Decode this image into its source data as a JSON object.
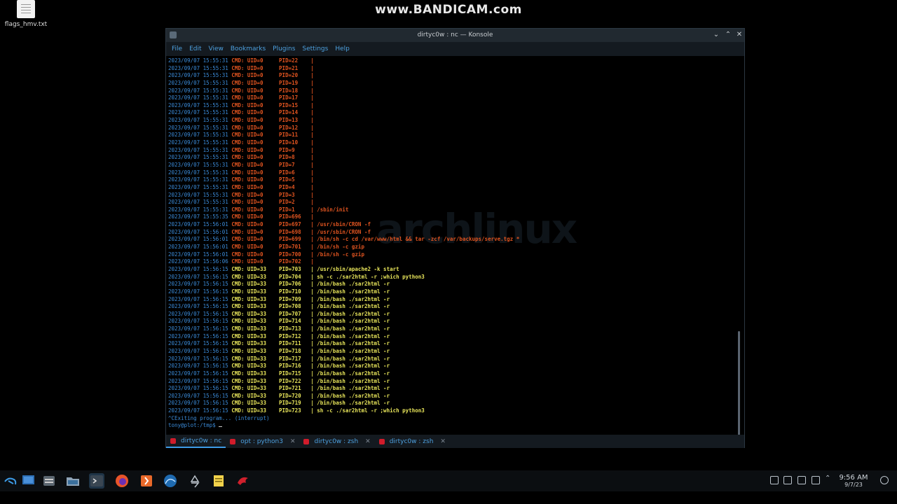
{
  "watermark": "www.BANDICAM.com",
  "desktop_icon": {
    "label": "flags_hmv.txt",
    "icon": "text-file-icon"
  },
  "window": {
    "title": "dirtyc0w : nc — Konsole",
    "controls": [
      "minimize-icon",
      "maximize-icon",
      "close-icon"
    ]
  },
  "menu": [
    "File",
    "Edit",
    "View",
    "Bookmarks",
    "Plugins",
    "Settings",
    "Help"
  ],
  "terminal": {
    "background_logo": "archlinux",
    "entries": [
      {
        "ts": "2023/09/07 15:55:31",
        "uid": "UID=0",
        "pid": "PID=22",
        "cmd": "",
        "color": "orange"
      },
      {
        "ts": "2023/09/07 15:55:31",
        "uid": "UID=0",
        "pid": "PID=21",
        "cmd": "",
        "color": "orange"
      },
      {
        "ts": "2023/09/07 15:55:31",
        "uid": "UID=0",
        "pid": "PID=20",
        "cmd": "",
        "color": "orange"
      },
      {
        "ts": "2023/09/07 15:55:31",
        "uid": "UID=0",
        "pid": "PID=19",
        "cmd": "",
        "color": "orange"
      },
      {
        "ts": "2023/09/07 15:55:31",
        "uid": "UID=0",
        "pid": "PID=18",
        "cmd": "",
        "color": "orange"
      },
      {
        "ts": "2023/09/07 15:55:31",
        "uid": "UID=0",
        "pid": "PID=17",
        "cmd": "",
        "color": "orange"
      },
      {
        "ts": "2023/09/07 15:55:31",
        "uid": "UID=0",
        "pid": "PID=15",
        "cmd": "",
        "color": "orange"
      },
      {
        "ts": "2023/09/07 15:55:31",
        "uid": "UID=0",
        "pid": "PID=14",
        "cmd": "",
        "color": "orange"
      },
      {
        "ts": "2023/09/07 15:55:31",
        "uid": "UID=0",
        "pid": "PID=13",
        "cmd": "",
        "color": "orange"
      },
      {
        "ts": "2023/09/07 15:55:31",
        "uid": "UID=0",
        "pid": "PID=12",
        "cmd": "",
        "color": "orange"
      },
      {
        "ts": "2023/09/07 15:55:31",
        "uid": "UID=0",
        "pid": "PID=11",
        "cmd": "",
        "color": "orange"
      },
      {
        "ts": "2023/09/07 15:55:31",
        "uid": "UID=0",
        "pid": "PID=10",
        "cmd": "",
        "color": "orange"
      },
      {
        "ts": "2023/09/07 15:55:31",
        "uid": "UID=0",
        "pid": "PID=9",
        "cmd": "",
        "color": "orange"
      },
      {
        "ts": "2023/09/07 15:55:31",
        "uid": "UID=0",
        "pid": "PID=8",
        "cmd": "",
        "color": "orange"
      },
      {
        "ts": "2023/09/07 15:55:31",
        "uid": "UID=0",
        "pid": "PID=7",
        "cmd": "",
        "color": "orange"
      },
      {
        "ts": "2023/09/07 15:55:31",
        "uid": "UID=0",
        "pid": "PID=6",
        "cmd": "",
        "color": "orange"
      },
      {
        "ts": "2023/09/07 15:55:31",
        "uid": "UID=0",
        "pid": "PID=5",
        "cmd": "",
        "color": "orange"
      },
      {
        "ts": "2023/09/07 15:55:31",
        "uid": "UID=0",
        "pid": "PID=4",
        "cmd": "",
        "color": "orange"
      },
      {
        "ts": "2023/09/07 15:55:31",
        "uid": "UID=0",
        "pid": "PID=3",
        "cmd": "",
        "color": "orange"
      },
      {
        "ts": "2023/09/07 15:55:31",
        "uid": "UID=0",
        "pid": "PID=2",
        "cmd": "",
        "color": "orange"
      },
      {
        "ts": "2023/09/07 15:55:31",
        "uid": "UID=0",
        "pid": "PID=1",
        "cmd": "/sbin/init",
        "color": "orange"
      },
      {
        "ts": "2023/09/07 15:55:35",
        "uid": "UID=0",
        "pid": "PID=696",
        "cmd": "",
        "color": "orange"
      },
      {
        "ts": "2023/09/07 15:56:01",
        "uid": "UID=0",
        "pid": "PID=697",
        "cmd": "/usr/sbin/CRON -f",
        "color": "orange"
      },
      {
        "ts": "2023/09/07 15:56:01",
        "uid": "UID=0",
        "pid": "PID=698",
        "cmd": "/usr/sbin/CRON -f",
        "color": "orange"
      },
      {
        "ts": "2023/09/07 15:56:01",
        "uid": "UID=0",
        "pid": "PID=699",
        "cmd": "/bin/sh -c cd /var/www/html && tar -zcf /var/backups/serve.tgz *",
        "color": "orange"
      },
      {
        "ts": "2023/09/07 15:56:01",
        "uid": "UID=0",
        "pid": "PID=701",
        "cmd": "/bin/sh -c gzip",
        "color": "orange"
      },
      {
        "ts": "2023/09/07 15:56:01",
        "uid": "UID=0",
        "pid": "PID=700",
        "cmd": "/bin/sh -c gzip",
        "color": "orange"
      },
      {
        "ts": "2023/09/07 15:56:06",
        "uid": "UID=0",
        "pid": "PID=702",
        "cmd": "",
        "color": "orange"
      },
      {
        "ts": "2023/09/07 15:56:15",
        "uid": "UID=33",
        "pid": "PID=703",
        "cmd": "/usr/sbin/apache2 -k start",
        "color": "yellow"
      },
      {
        "ts": "2023/09/07 15:56:15",
        "uid": "UID=33",
        "pid": "PID=704",
        "cmd": "sh -c ./sar2html -r ;which python3",
        "color": "yellow"
      },
      {
        "ts": "2023/09/07 15:56:15",
        "uid": "UID=33",
        "pid": "PID=706",
        "cmd": "/bin/bash ./sar2html -r",
        "color": "yellow"
      },
      {
        "ts": "2023/09/07 15:56:15",
        "uid": "UID=33",
        "pid": "PID=710",
        "cmd": "/bin/bash ./sar2html -r",
        "color": "yellow"
      },
      {
        "ts": "2023/09/07 15:56:15",
        "uid": "UID=33",
        "pid": "PID=709",
        "cmd": "/bin/bash ./sar2html -r",
        "color": "yellow"
      },
      {
        "ts": "2023/09/07 15:56:15",
        "uid": "UID=33",
        "pid": "PID=708",
        "cmd": "/bin/bash ./sar2html -r",
        "color": "yellow"
      },
      {
        "ts": "2023/09/07 15:56:15",
        "uid": "UID=33",
        "pid": "PID=707",
        "cmd": "/bin/bash ./sar2html -r",
        "color": "yellow"
      },
      {
        "ts": "2023/09/07 15:56:15",
        "uid": "UID=33",
        "pid": "PID=714",
        "cmd": "/bin/bash ./sar2html -r",
        "color": "yellow"
      },
      {
        "ts": "2023/09/07 15:56:15",
        "uid": "UID=33",
        "pid": "PID=713",
        "cmd": "/bin/bash ./sar2html -r",
        "color": "yellow"
      },
      {
        "ts": "2023/09/07 15:56:15",
        "uid": "UID=33",
        "pid": "PID=712",
        "cmd": "/bin/bash ./sar2html -r",
        "color": "yellow"
      },
      {
        "ts": "2023/09/07 15:56:15",
        "uid": "UID=33",
        "pid": "PID=711",
        "cmd": "/bin/bash ./sar2html -r",
        "color": "yellow"
      },
      {
        "ts": "2023/09/07 15:56:15",
        "uid": "UID=33",
        "pid": "PID=718",
        "cmd": "/bin/bash ./sar2html -r",
        "color": "yellow"
      },
      {
        "ts": "2023/09/07 15:56:15",
        "uid": "UID=33",
        "pid": "PID=717",
        "cmd": "/bin/bash ./sar2html -r",
        "color": "yellow"
      },
      {
        "ts": "2023/09/07 15:56:15",
        "uid": "UID=33",
        "pid": "PID=716",
        "cmd": "/bin/bash ./sar2html -r",
        "color": "yellow"
      },
      {
        "ts": "2023/09/07 15:56:15",
        "uid": "UID=33",
        "pid": "PID=715",
        "cmd": "/bin/bash ./sar2html -r",
        "color": "yellow"
      },
      {
        "ts": "2023/09/07 15:56:15",
        "uid": "UID=33",
        "pid": "PID=722",
        "cmd": "/bin/bash ./sar2html -r",
        "color": "yellow"
      },
      {
        "ts": "2023/09/07 15:56:15",
        "uid": "UID=33",
        "pid": "PID=721",
        "cmd": "/bin/bash ./sar2html -r",
        "color": "yellow"
      },
      {
        "ts": "2023/09/07 15:56:15",
        "uid": "UID=33",
        "pid": "PID=720",
        "cmd": "/bin/bash ./sar2html -r",
        "color": "yellow"
      },
      {
        "ts": "2023/09/07 15:56:15",
        "uid": "UID=33",
        "pid": "PID=719",
        "cmd": "/bin/bash ./sar2html -r",
        "color": "yellow"
      },
      {
        "ts": "2023/09/07 15:56:15",
        "uid": "UID=33",
        "pid": "PID=723",
        "cmd": "sh -c ./sar2html -r ;which python3",
        "color": "yellow"
      }
    ],
    "cmd_label": "CMD:",
    "separator": "|",
    "interrupt_line": "^CExiting program... (interrupt)",
    "prompt": "tony@plot:/tmp$ "
  },
  "tabs": [
    {
      "label": "dirtyc0w : nc",
      "active": true
    },
    {
      "label": "opt : python3",
      "active": false
    },
    {
      "label": "dirtyc0w : zsh",
      "active": false
    },
    {
      "label": "dirtyc0w : zsh",
      "active": false
    }
  ],
  "taskbar": {
    "apps": [
      "kali-menu-icon",
      "desktop-icon",
      "file-manager-icon",
      "folder-icon",
      "terminal-icon",
      "firefox-icon",
      "burpsuite-icon",
      "wireshark-icon",
      "recycle-icon",
      "notes-icon",
      "kali-dragon-icon"
    ],
    "tray": [
      "network-icon",
      "clipboard-icon",
      "volume-muted-icon",
      "display-icon",
      "expand-tray-icon",
      "power-icon"
    ],
    "clock_time": "9:56 AM",
    "clock_date": "9/7/23"
  },
  "colors": {
    "orange": "#e05420",
    "yellow": "#e8e55a",
    "blue": "#3b8bd8",
    "accent": "#3d9be6"
  }
}
